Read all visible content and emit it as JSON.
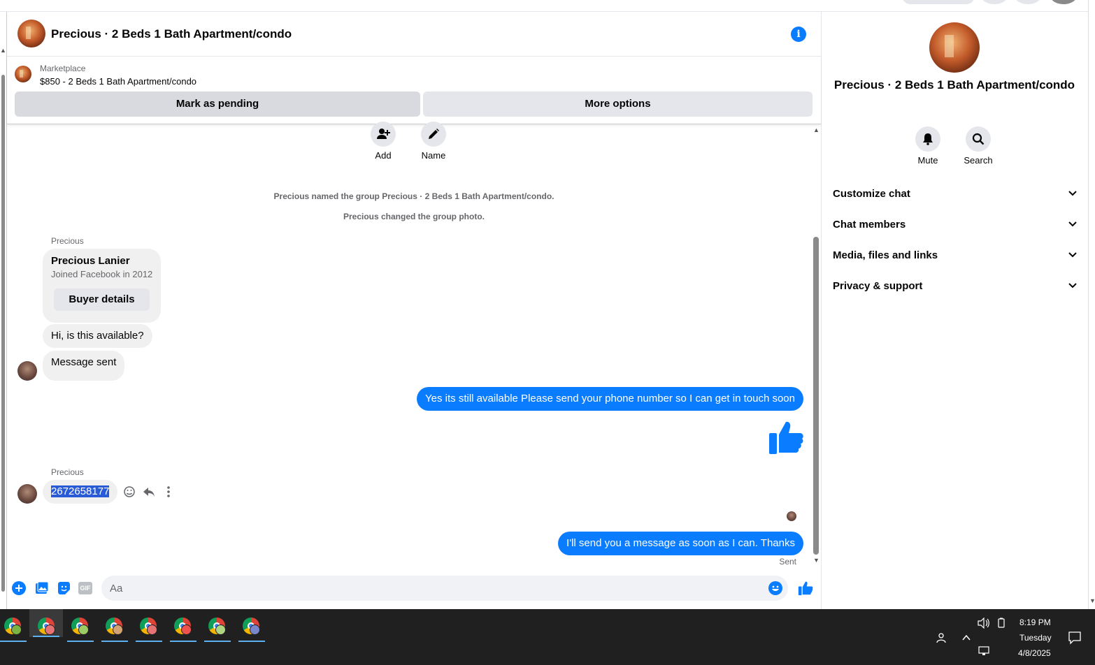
{
  "header": {
    "title": "Precious · 2 Beds 1 Bath Apartment/condo",
    "info_glyph": "i"
  },
  "marketplace": {
    "label": "Marketplace",
    "price_title": "$850 - 2 Beds 1 Bath Apartment/condo",
    "mark_pending": "Mark as pending",
    "more_options": "More options"
  },
  "group_actions": {
    "add": "Add",
    "name": "Name"
  },
  "system_messages": [
    "Precious named the group Precious · 2 Beds 1 Bath Apartment/condo.",
    "Precious changed the group photo."
  ],
  "messages": {
    "sender_name": "Precious",
    "profile_card": {
      "name": "Precious Lanier",
      "joined": "Joined Facebook in 2012",
      "button": "Buyer details"
    },
    "in_1": "Hi, is this available?",
    "in_2": "Message sent",
    "out_1": "Yes its still available Please send your phone number so I can get in touch soon",
    "sender_name_2": "Precious",
    "in_3": "2672658177",
    "out_2": "I'll send you a message as soon as I can. Thanks",
    "status": "Sent"
  },
  "composer": {
    "placeholder": "Aa",
    "gif": "GIF"
  },
  "sidebar": {
    "title": "Precious · 2 Beds 1 Bath Apartment/condo",
    "mute": "Mute",
    "search": "Search",
    "sections": [
      "Customize chat",
      "Chat members",
      "Media, files and links",
      "Privacy & support"
    ]
  },
  "taskbar": {
    "time": "8:19 PM",
    "day": "Tuesday",
    "date": "4/8/2025",
    "app_count": 8
  },
  "colors": {
    "accent": "#0a7cff",
    "bubble_in": "#f0f0f0",
    "button_bg": "#e4e6eb"
  }
}
